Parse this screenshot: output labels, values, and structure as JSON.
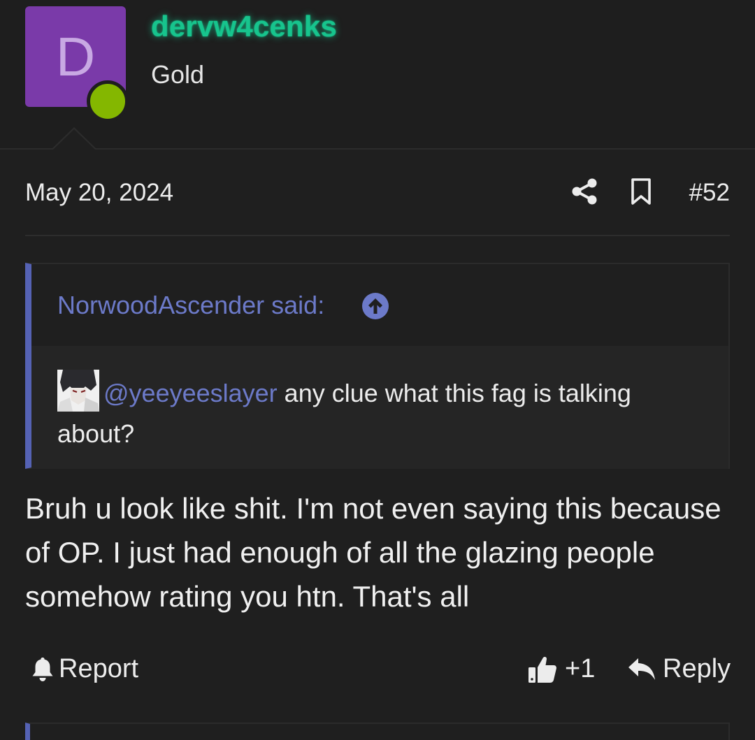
{
  "user": {
    "avatar_letter": "D",
    "username": "dervw4cenks",
    "title": "Gold",
    "status": "online",
    "colors": {
      "avatar_bg": "#7a3aa9",
      "username": "#17c48d",
      "online": "#84b700"
    }
  },
  "post": {
    "date": "May 20, 2024",
    "number": "#52",
    "share_icon": "share-icon",
    "bookmark_icon": "bookmark-icon",
    "quote": {
      "author_said": "NorwoodAscender said:",
      "mention": "@yeeyeeslayer",
      "text": " any clue what this fag is talking about?"
    },
    "body": "Bruh u look like shit. I'm not even saying this because of OP. I just had enough of all the glazing people somehow rating you htn. That's all"
  },
  "actions": {
    "report_label": "Report",
    "like_count": "+1",
    "reply_label": "Reply"
  },
  "colors": {
    "background": "#1f1f1f",
    "accent": "#5562b4",
    "link": "#6c7ac9"
  }
}
